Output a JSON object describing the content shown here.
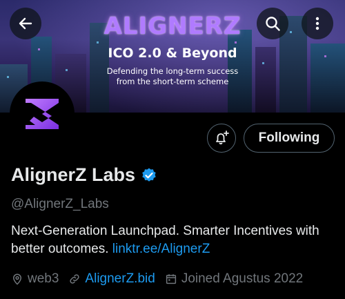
{
  "banner": {
    "logo_text": "ALIGNERZ",
    "headline": "ICO 2.0 & Beyond",
    "subline1": "Defending the long-term success",
    "subline2": "from the short-term scheme"
  },
  "top_bar": {
    "back_icon": "arrow-left-icon",
    "search_icon": "search-icon",
    "more_icon": "more-vertical-icon"
  },
  "profile": {
    "display_name": "AlignerZ Labs",
    "handle": "@AlignerZ_Labs",
    "verified": true,
    "bio_text": "Next-Generation Launchpad.  Smarter Incentives with better outcomes. ",
    "bio_link": "linktr.ee/AlignerZ"
  },
  "actions": {
    "following_label": "Following",
    "notify_icon": "bell-plus-icon"
  },
  "meta": {
    "location": "web3",
    "website": "AlignerZ.bid",
    "joined": "Joined Agustus 2022"
  },
  "colors": {
    "accent": "#1d9bf0",
    "muted": "#71767b",
    "brand_purple": "#a955ff"
  }
}
